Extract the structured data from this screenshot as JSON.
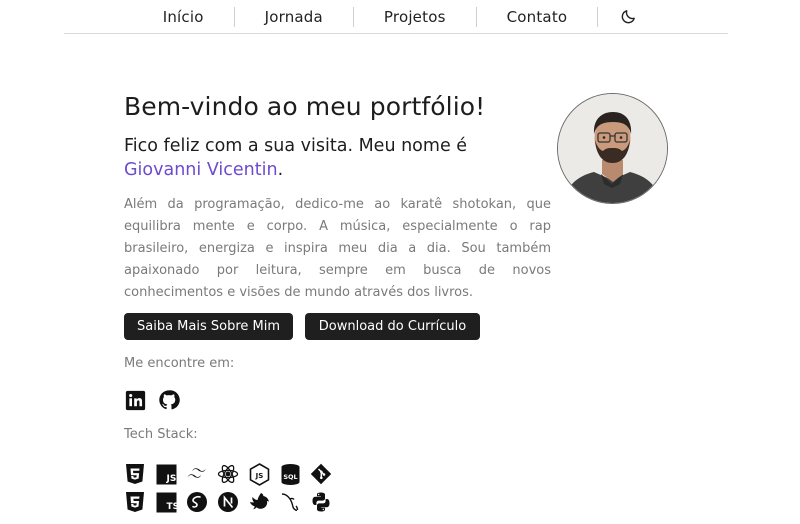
{
  "nav": {
    "items": [
      "Início",
      "Jornada",
      "Projetos",
      "Contato"
    ],
    "theme_icon": "moon-icon"
  },
  "hero": {
    "title": "Bem-vindo ao meu portfólio!",
    "subtitle_prefix": "Fico feliz com a sua visita. Meu nome é ",
    "name": "Giovanni Vicentin",
    "subtitle_suffix": ".",
    "bio": "Além da programação, dedico-me ao karatê shotokan, que equilibra mente e corpo. A música, especialmente o rap brasileiro, energiza e inspira meu dia a dia. Sou também apaixonado por leitura, sempre em busca de novos conhecimentos e visões de mundo através dos livros."
  },
  "buttons": {
    "about": "Saiba Mais Sobre Mim",
    "cv": "Download do Currículo"
  },
  "social": {
    "label": "Me encontre em:",
    "icons": [
      "linkedin-icon",
      "github-icon"
    ]
  },
  "stack": {
    "label": "Tech Stack:",
    "row1": [
      "html5-icon",
      "javascript-icon",
      "tailwind-icon",
      "react-icon",
      "nodejs-icon",
      "sql-icon",
      "git-icon"
    ],
    "row2": [
      "css3-icon",
      "typescript-icon",
      "sass-icon",
      "nextjs-icon",
      "nestjs-icon",
      "mysql-icon",
      "python-icon"
    ]
  },
  "colors": {
    "accent": "#6d4ad0",
    "button_bg": "#1f1f1f",
    "muted_text": "#7a7a7a"
  },
  "avatar": "profile-photo"
}
